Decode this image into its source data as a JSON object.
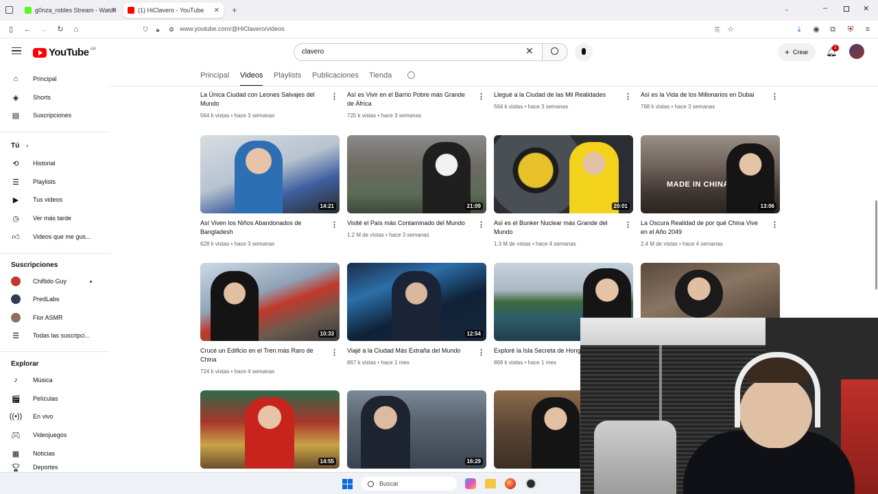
{
  "browser": {
    "tabs": [
      {
        "label": "g0nza_robles Stream - Watch Li",
        "color": "#53fc18"
      },
      {
        "label": "(1) HiClavero - YouTube",
        "color": "#ff0000"
      }
    ],
    "url": "www.youtube.com/@HiClavero/videos"
  },
  "header": {
    "logo_text": "YouTube",
    "logo_region": "AR",
    "search_value": "clavero",
    "create_label": "Crear",
    "notif_count": "1"
  },
  "sidebar": {
    "main": [
      {
        "label": "Principal",
        "icon": "home-icon"
      },
      {
        "label": "Shorts",
        "icon": "shorts-icon"
      },
      {
        "label": "Suscripciones",
        "icon": "subscriptions-icon"
      }
    ],
    "you_title": "Tú",
    "you": [
      {
        "label": "Historial",
        "icon": "history-icon"
      },
      {
        "label": "Playlists",
        "icon": "playlists-icon"
      },
      {
        "label": "Tus videos",
        "icon": "your-videos-icon"
      },
      {
        "label": "Ver más tarde",
        "icon": "watch-later-icon"
      },
      {
        "label": "Videos que me gus...",
        "icon": "liked-icon"
      }
    ],
    "subs_title": "Suscripciones",
    "subs": [
      {
        "label": "Chiflido Guy",
        "color": "#c0392b"
      },
      {
        "label": "PredLabs",
        "color": "#2c3e50"
      },
      {
        "label": "Flor ASMR",
        "color": "#8e6f5a"
      },
      {
        "label": "Todas las suscripci...",
        "color": ""
      }
    ],
    "explore_title": "Explorar",
    "explore": [
      {
        "label": "Música",
        "icon": "music-icon"
      },
      {
        "label": "Películas",
        "icon": "movies-icon"
      },
      {
        "label": "En vivo",
        "icon": "live-icon"
      },
      {
        "label": "Videojuegos",
        "icon": "gaming-icon"
      },
      {
        "label": "Noticias",
        "icon": "news-icon"
      },
      {
        "label": "Deportes",
        "icon": "sports-icon"
      }
    ]
  },
  "channel_tabs": [
    "Principal",
    "Videos",
    "Playlists",
    "Publicaciones",
    "Tienda"
  ],
  "videos_row0": [
    {
      "title": "La Única Ciudad con Leones Salvajes del Mundo",
      "meta": "564 k vistas • hace 3 semanas"
    },
    {
      "title": "Así es Vivir en el Barrio Pobre más Grande de África",
      "meta": "725 k vistas • hace 3 semanas"
    },
    {
      "title": "Llegué a la Ciudad de las Mil Realidades",
      "meta": "564 k vistas • hace 3 semanas"
    },
    {
      "title": "Así es la Vida de los Millonarios en Dubai",
      "meta": "768 k vistas • hace 3 semanas"
    }
  ],
  "videos_row1": [
    {
      "title": "Así Viven los Niños Abandonados de Bangladesh",
      "meta": "628 k vistas • hace 3 semanas",
      "duration": "14:21"
    },
    {
      "title": "Visité el País más Contaminado del Mundo",
      "meta": "1.2 M de vistas • hace 3 semanas",
      "duration": "21:09"
    },
    {
      "title": "Así es el Bunker Nuclear más Grande del Mundo",
      "meta": "1.3 M de vistas • hace 4 semanas",
      "duration": "20:01"
    },
    {
      "title": "La Oscura Realidad de por qué China Vive en el Año 2049",
      "meta": "2.4 M de vistas • hace 4 semanas",
      "duration": "13:06",
      "thumb_text": "MADE IN CHINA"
    }
  ],
  "videos_row2": [
    {
      "title": "Crucé un Edificio en el Tren más Raro de China",
      "meta": "724 k vistas • hace 4 semanas",
      "duration": "10:33"
    },
    {
      "title": "Viajé a la Ciudad Más Extraña del Mundo",
      "meta": "867 k vistas • hace 1 mes",
      "duration": "12:54"
    },
    {
      "title": "Exploré la Isla Secreta de Hong",
      "meta": "868 k vistas • hace 1 mes",
      "duration": ""
    },
    {
      "title": "",
      "meta": "",
      "duration": ""
    }
  ],
  "videos_row3": [
    {
      "duration": "14:55"
    },
    {
      "duration": "16:29"
    },
    {
      "duration": ""
    }
  ],
  "taskbar": {
    "search_label": "Buscar"
  }
}
